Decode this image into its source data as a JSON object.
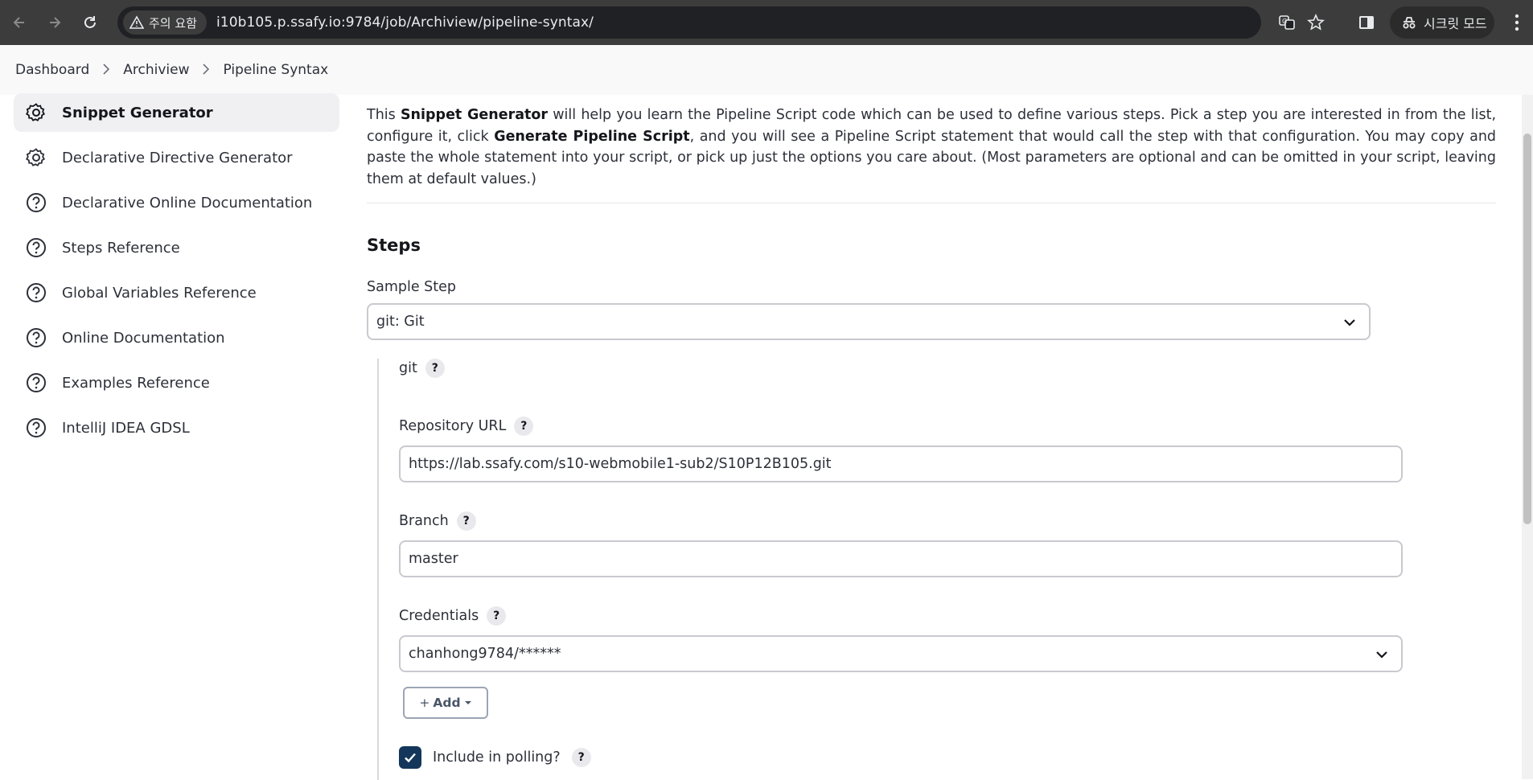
{
  "browser": {
    "security_chip": "주의 요함",
    "url": "i10b105.p.ssafy.io:9784/job/Archiview/pipeline-syntax/",
    "incognito_label": "시크릿 모드"
  },
  "breadcrumb": {
    "items": [
      "Dashboard",
      "Archiview",
      "Pipeline Syntax"
    ]
  },
  "sidebar": {
    "items": [
      {
        "label": "Snippet Generator",
        "icon": "gear-icon"
      },
      {
        "label": "Declarative Directive Generator",
        "icon": "gear-icon"
      },
      {
        "label": "Declarative Online Documentation",
        "icon": "help-circle-icon"
      },
      {
        "label": "Steps Reference",
        "icon": "help-circle-icon"
      },
      {
        "label": "Global Variables Reference",
        "icon": "help-circle-icon"
      },
      {
        "label": "Online Documentation",
        "icon": "help-circle-icon"
      },
      {
        "label": "Examples Reference",
        "icon": "help-circle-icon"
      },
      {
        "label": "IntelliJ IDEA GDSL",
        "icon": "help-circle-icon"
      }
    ]
  },
  "intro": {
    "p1": "This ",
    "b1": "Snippet Generator",
    "p2": " will help you learn the Pipeline Script code which can be used to define various steps. Pick a step you are interested in from the list, configure it, click ",
    "b2": "Generate Pipeline Script",
    "p3": ", and you will see a Pipeline Script statement that would call the step with that configuration. You may copy and paste the whole statement into your script, or pick up just the options you care about. (Most parameters are optional and can be omitted in your script, leaving them at default values.)"
  },
  "steps": {
    "title": "Steps",
    "sample_step_label": "Sample Step",
    "sample_step_value": "git: Git",
    "git_label": "git",
    "repo_url_label": "Repository URL",
    "repo_url_value": "https://lab.ssafy.com/s10-webmobile1-sub2/S10P12B105.git",
    "branch_label": "Branch",
    "branch_value": "master",
    "credentials_label": "Credentials",
    "credentials_value": "chanhong9784/******",
    "add_button": "Add",
    "include_polling_label": "Include in polling?",
    "help_glyph": "?"
  },
  "colors": {
    "chrome_bg": "#3c3c3c",
    "omnibox_bg": "#202124",
    "checkbox_checked": "#14365a"
  }
}
